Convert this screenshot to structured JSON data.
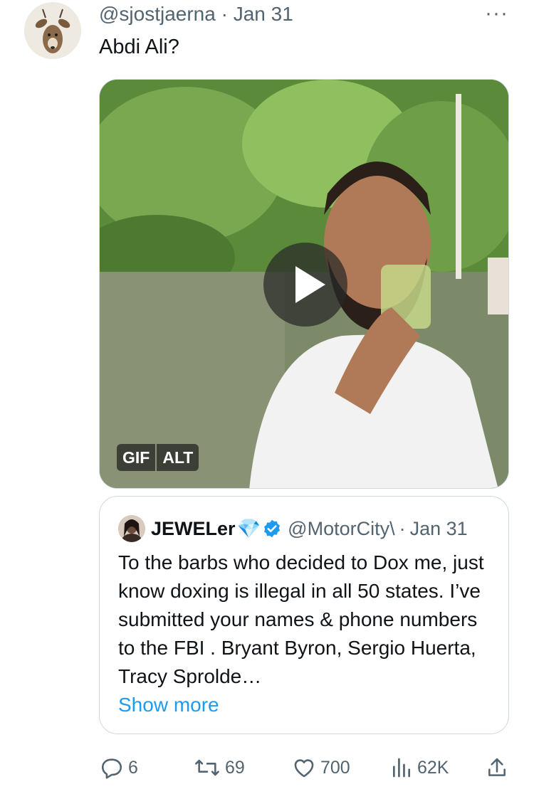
{
  "tweet": {
    "handle": "@sjostjaerna",
    "separator": "·",
    "date": "Jan 31",
    "more_icon": "···",
    "text": "Abdi Ali?",
    "media": {
      "badge_gif": "GIF",
      "badge_alt": "ALT"
    }
  },
  "quoted": {
    "name": "JEWELer",
    "gem": "💎",
    "handle": "@MotorCity\\",
    "separator": "·",
    "date": "Jan 31",
    "text": "To the barbs who decided to Dox me, just know doxing is illegal in all 50 states. I’ve submitted your names & phone numbers to the FBI . Bryant Byron, Sergio Huerta, Tracy Sprolde…",
    "show_more": "Show more"
  },
  "actions": {
    "replies": "6",
    "reposts": "69",
    "likes": "700",
    "views": "62K"
  },
  "colors": {
    "accent": "#1d9bf0",
    "muted": "#536471",
    "text": "#0f1419",
    "border": "#cfd9de"
  }
}
